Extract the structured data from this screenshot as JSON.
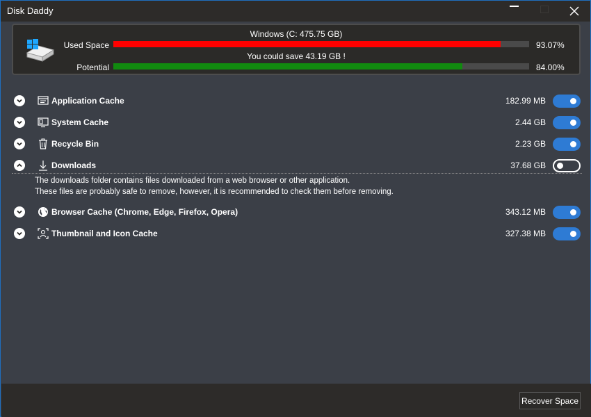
{
  "window": {
    "title": "Disk Daddy"
  },
  "titlebar": {
    "minimize_icon": "minimize-icon",
    "maximize_icon": "maximize-icon",
    "close_icon": "close-icon"
  },
  "drive": {
    "title": "Windows (C: 475.75 GB)",
    "used_label": "Used Space",
    "used_percent": "93.07%",
    "used_fraction": 0.9307,
    "save_text": "You could save 43.19 GB !",
    "potential_label": "Potential",
    "potential_percent": "84.00%",
    "potential_fraction": 0.84,
    "colors": {
      "used": "#ff0000",
      "potential": "#118a0f",
      "accent": "#2e7bd4"
    }
  },
  "categories": [
    {
      "label": "Application Cache",
      "size": "182.99 MB",
      "icon": "app-cache-icon",
      "enabled": true,
      "expanded": false
    },
    {
      "label": "System Cache",
      "size": "2.44 GB",
      "icon": "system-cache-icon",
      "enabled": true,
      "expanded": false
    },
    {
      "label": "Recycle Bin",
      "size": "2.23 GB",
      "icon": "recycle-bin-icon",
      "enabled": true,
      "expanded": false
    },
    {
      "label": "Downloads",
      "size": "37.68 GB",
      "icon": "download-icon",
      "enabled": false,
      "expanded": true,
      "description": [
        "The downloads folder contains files downloaded from a web browser or other application.",
        "These files are probably safe to remove, however, it is recommended to check them before removing."
      ]
    },
    {
      "label": "Browser Cache (Chrome, Edge, Firefox, Opera)",
      "size": "343.12 MB",
      "icon": "globe-icon",
      "enabled": true,
      "expanded": false
    },
    {
      "label": "Thumbnail and Icon Cache",
      "size": "327.38 MB",
      "icon": "thumbnail-icon",
      "enabled": true,
      "expanded": false
    }
  ],
  "footer": {
    "recover_label": "Recover Space"
  }
}
